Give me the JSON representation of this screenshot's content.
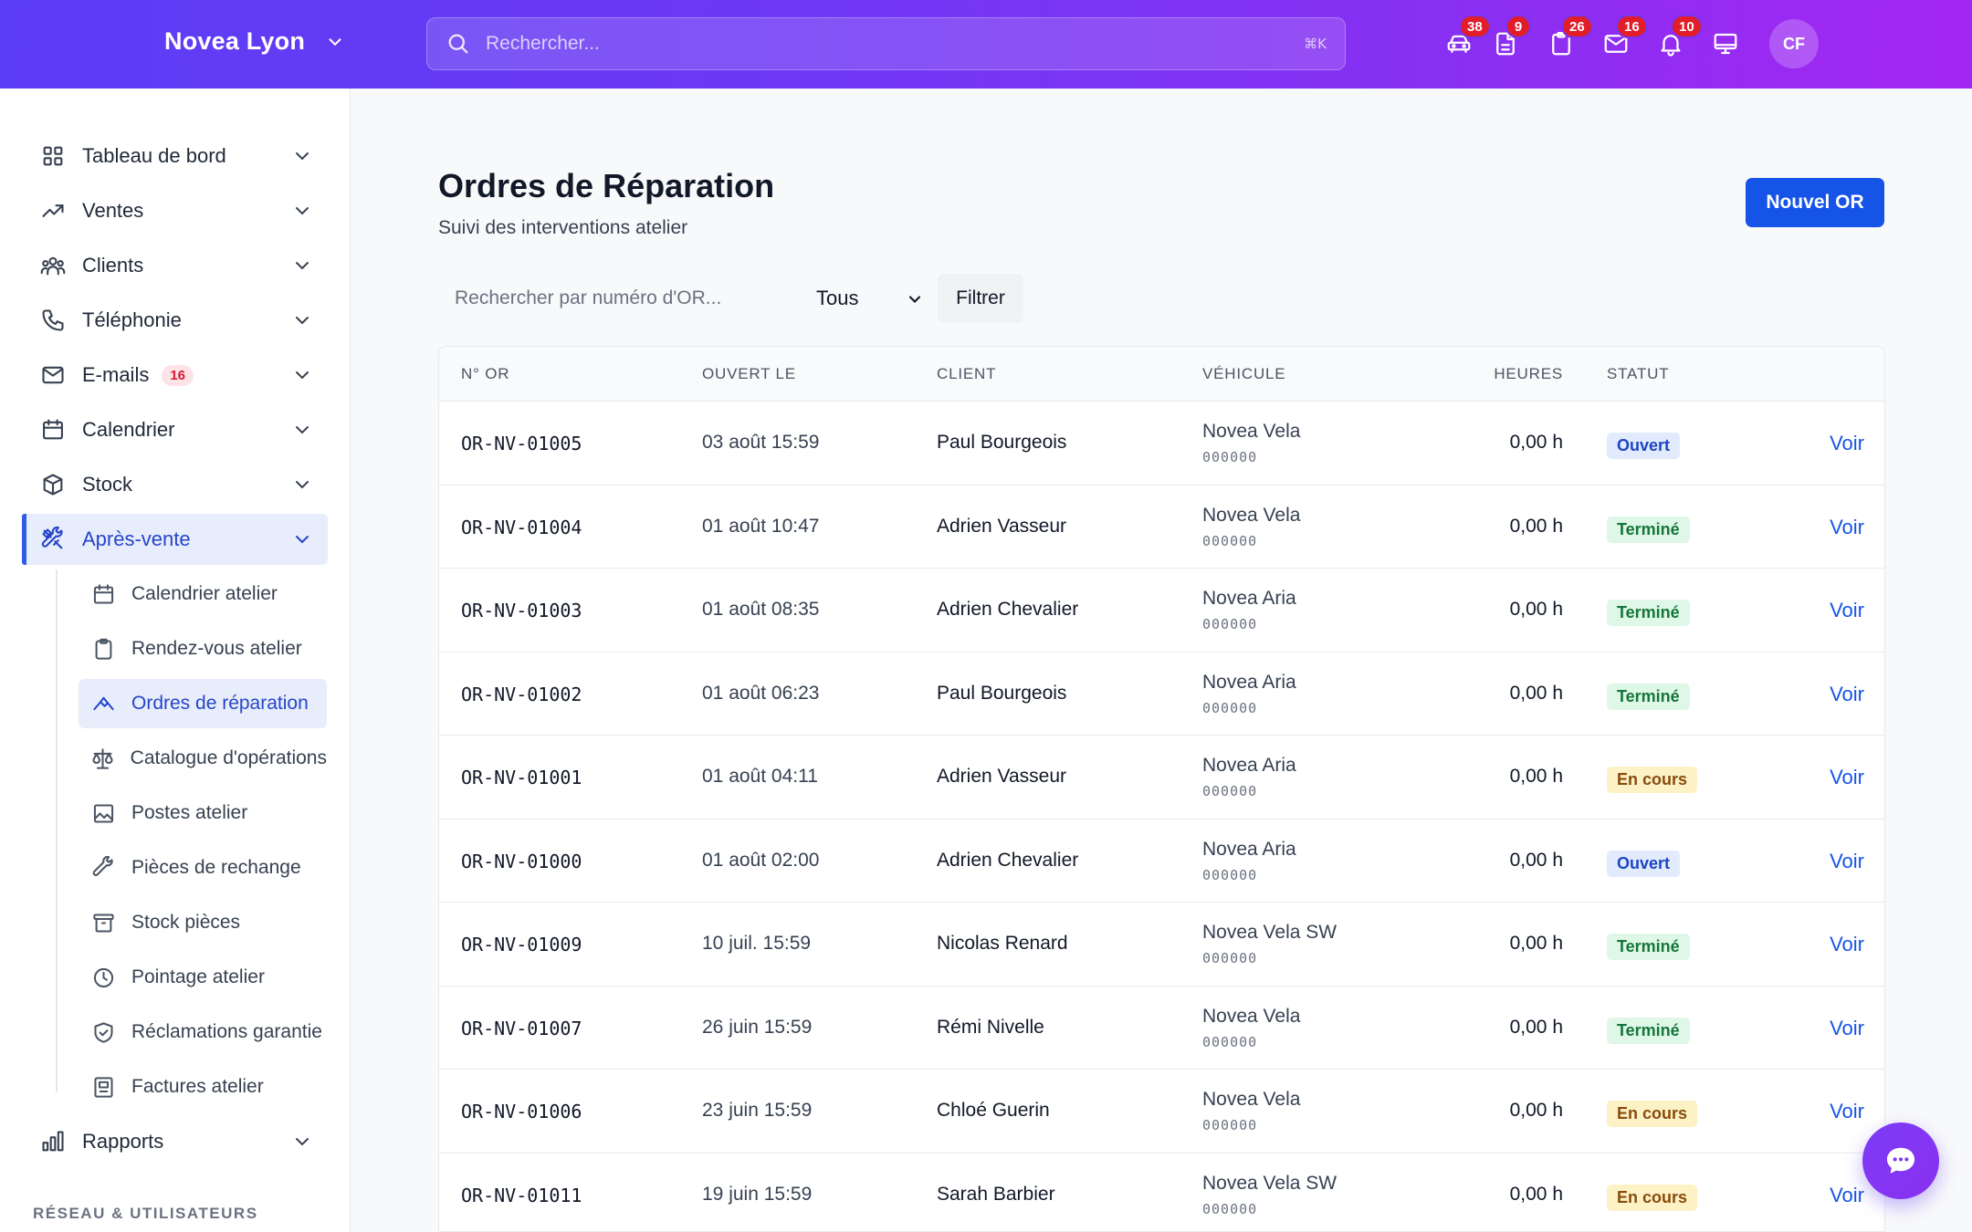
{
  "topbar": {
    "brand": "Novea Lyon",
    "search_placeholder": "Rechercher...",
    "shortcut": "⌘K",
    "icons": [
      {
        "name": "car-icon",
        "badge": "38"
      },
      {
        "name": "document-icon",
        "badge": "9"
      },
      {
        "name": "clipboard-icon",
        "badge": "26"
      },
      {
        "name": "mail-icon",
        "badge": "16"
      },
      {
        "name": "bell-icon",
        "badge": "10"
      },
      {
        "name": "monitor-icon",
        "badge": ""
      }
    ],
    "avatar": "CF"
  },
  "sidebar": {
    "items": [
      {
        "label": "Tableau de bord",
        "icon": "grid-icon"
      },
      {
        "label": "Ventes",
        "icon": "trend-icon"
      },
      {
        "label": "Clients",
        "icon": "users-icon"
      },
      {
        "label": "Téléphonie",
        "icon": "phone-icon"
      },
      {
        "label": "E-mails",
        "icon": "mail-icon",
        "badge": "16"
      },
      {
        "label": "Calendrier",
        "icon": "calendar-icon"
      },
      {
        "label": "Stock",
        "icon": "box-icon"
      },
      {
        "label": "Après-vente",
        "icon": "tools-icon",
        "active": true
      },
      {
        "label": "Rapports",
        "icon": "chart-icon"
      }
    ],
    "sub_items": [
      {
        "label": "Calendrier atelier",
        "icon": "calendar-icon"
      },
      {
        "label": "Rendez-vous atelier",
        "icon": "clipboard-icon"
      },
      {
        "label": "Ordres de réparation",
        "icon": "wrench-icon",
        "active": true
      },
      {
        "label": "Catalogue d'opérations",
        "icon": "scale-icon"
      },
      {
        "label": "Postes atelier",
        "icon": "image-icon"
      },
      {
        "label": "Pièces de rechange",
        "icon": "tool-icon"
      },
      {
        "label": "Stock pièces",
        "icon": "archive-icon"
      },
      {
        "label": "Pointage atelier",
        "icon": "clock-icon"
      },
      {
        "label": "Réclamations garantie",
        "icon": "shield-icon"
      },
      {
        "label": "Factures atelier",
        "icon": "receipt-icon"
      }
    ],
    "section_label": "RÉSEAU & UTILISATEURS"
  },
  "main": {
    "title": "Ordres de Réparation",
    "subtitle": "Suivi des interventions atelier",
    "new_button": "Nouvel OR",
    "search_placeholder": "Rechercher par numéro d'OR...",
    "status_filter": "Tous",
    "filter_button": "Filtrer"
  },
  "table": {
    "headers": [
      "N° OR",
      "OUVERT LE",
      "CLIENT",
      "VÉHICULE",
      "HEURES",
      "STATUT"
    ],
    "rows": [
      {
        "or": "OR-NV-01005",
        "date": "03 août 15:59",
        "client": "Paul Bourgeois",
        "vehicle": "Novea Vela",
        "vin": "000000",
        "hours": "0,00 h",
        "status": "Ouvert",
        "action": "Voir"
      },
      {
        "or": "OR-NV-01004",
        "date": "01 août 10:47",
        "client": "Adrien Vasseur",
        "vehicle": "Novea Vela",
        "vin": "000000",
        "hours": "0,00 h",
        "status": "Terminé",
        "action": "Voir"
      },
      {
        "or": "OR-NV-01003",
        "date": "01 août 08:35",
        "client": "Adrien Chevalier",
        "vehicle": "Novea Aria",
        "vin": "000000",
        "hours": "0,00 h",
        "status": "Terminé",
        "action": "Voir"
      },
      {
        "or": "OR-NV-01002",
        "date": "01 août 06:23",
        "client": "Paul Bourgeois",
        "vehicle": "Novea Aria",
        "vin": "000000",
        "hours": "0,00 h",
        "status": "Terminé",
        "action": "Voir"
      },
      {
        "or": "OR-NV-01001",
        "date": "01 août 04:11",
        "client": "Adrien Vasseur",
        "vehicle": "Novea Aria",
        "vin": "000000",
        "hours": "0,00 h",
        "status": "En cours",
        "action": "Voir"
      },
      {
        "or": "OR-NV-01000",
        "date": "01 août 02:00",
        "client": "Adrien Chevalier",
        "vehicle": "Novea Aria",
        "vin": "000000",
        "hours": "0,00 h",
        "status": "Ouvert",
        "action": "Voir"
      },
      {
        "or": "OR-NV-01009",
        "date": "10 juil. 15:59",
        "client": "Nicolas Renard",
        "vehicle": "Novea Vela SW",
        "vin": "000000",
        "hours": "0,00 h",
        "status": "Terminé",
        "action": "Voir"
      },
      {
        "or": "OR-NV-01007",
        "date": "26 juin 15:59",
        "client": "Rémi Nivelle",
        "vehicle": "Novea Vela",
        "vin": "000000",
        "hours": "0,00 h",
        "status": "Terminé",
        "action": "Voir"
      },
      {
        "or": "OR-NV-01006",
        "date": "23 juin 15:59",
        "client": "Chloé Guerin",
        "vehicle": "Novea Vela",
        "vin": "000000",
        "hours": "0,00 h",
        "status": "En cours",
        "action": "Voir"
      },
      {
        "or": "OR-NV-01011",
        "date": "19 juin 15:59",
        "client": "Sarah Barbier",
        "vehicle": "Novea Vela SW",
        "vin": "000000",
        "hours": "0,00 h",
        "status": "En cours",
        "action": "Voir"
      }
    ]
  },
  "colors": {
    "accent": "#1554e6",
    "topbar_start": "#5b3df5",
    "topbar_end": "#a327f2"
  }
}
